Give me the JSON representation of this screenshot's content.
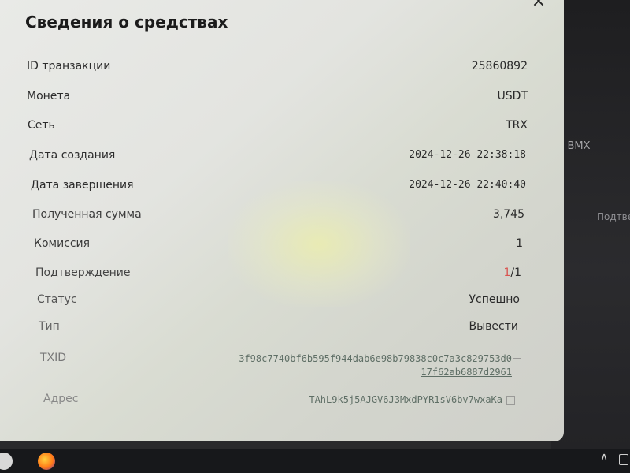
{
  "modal": {
    "title": "Сведения о средствах",
    "close_symbol": "×",
    "rows": [
      {
        "label": "ID транзакции",
        "value": "25860892"
      },
      {
        "label": "Монета",
        "value": "USDT"
      },
      {
        "label": "Сеть",
        "value": "TRX"
      },
      {
        "label": "Дата создания",
        "value": "2024-12-26 22:38:18"
      },
      {
        "label": "Дата завершения",
        "value": "2024-12-26 22:40:40"
      },
      {
        "label": "Полученная сумма",
        "value": "3,745"
      },
      {
        "label": "Комиссия",
        "value": "1"
      },
      {
        "label": "Подтверждение",
        "value_current": "1",
        "value_sep_total": "/1"
      },
      {
        "label": "Статус",
        "value": "Успешно"
      },
      {
        "label": "Тип",
        "value": "Вывести"
      },
      {
        "label": "TXID",
        "value_line1": "3f98c7740bf6b595f944dab6e98b79838c0c7a3c829753d0",
        "value_line2": "17f62ab6887d2961"
      },
      {
        "label": "Адрес",
        "value": "TAhL9k5j5AJGV6J3MxdPYR1sV6bv7wxaKa"
      }
    ]
  },
  "background": {
    "fragment_1": "л BMX",
    "fragment_2": "Подтве"
  },
  "colors": {
    "accent_red": "#d9534f",
    "link_gray": "#5f6f66"
  }
}
